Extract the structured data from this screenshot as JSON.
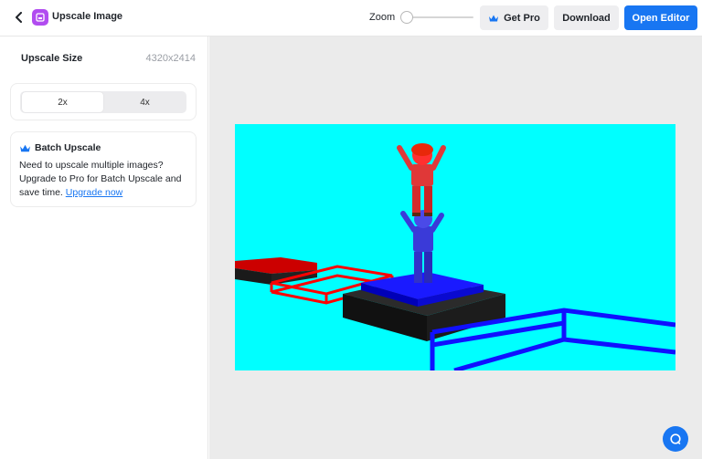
{
  "header": {
    "title": "Upscale Image",
    "zoom_label": "Zoom",
    "get_pro_label": "Get Pro",
    "download_label": "Download",
    "open_editor_label": "Open Editor"
  },
  "sidebar": {
    "upscale_size_label": "Upscale Size",
    "upscale_size_value": "4320x2414",
    "scale_options": [
      "2x",
      "4x"
    ],
    "selected_scale": "2x",
    "batch": {
      "title": "Batch Upscale",
      "description": "Need to upscale multiple images? Upgrade to Pro for Batch Upscale and save time.",
      "link_label": "Upgrade now"
    }
  },
  "zoom": {
    "level_fraction": 0.0
  },
  "colors": {
    "accent": "#1876f2",
    "app_icon": "#b14cf0",
    "canvas_bg": "#ebebeb",
    "image_sky": "#00ffff"
  },
  "icons": {
    "back": "chevron-left-icon",
    "app": "upscale-app-icon",
    "crown": "crown-icon",
    "help": "chat-bubble-icon"
  }
}
